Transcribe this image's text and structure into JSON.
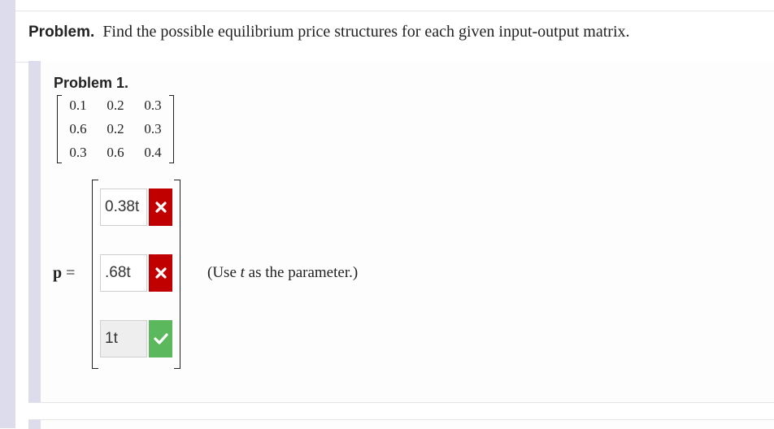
{
  "header": {
    "label": "Problem.",
    "text": "Find the possible equilibrium price structures for each given input-output matrix."
  },
  "problem": {
    "title": "Problem 1.",
    "matrix": [
      [
        "0.1",
        "0.2",
        "0.3"
      ],
      [
        "0.6",
        "0.2",
        "0.3"
      ],
      [
        "0.3",
        "0.6",
        "0.4"
      ]
    ],
    "vector_label": "p",
    "equals": "=",
    "answers": [
      {
        "value": "0.38t",
        "status": "incorrect",
        "icon": "x-icon",
        "color": "#c00000"
      },
      {
        "value": ".68t",
        "status": "incorrect",
        "icon": "x-icon",
        "color": "#c00000"
      },
      {
        "value": "1t",
        "status": "correct",
        "icon": "check-icon",
        "color": "#5cb85c"
      }
    ],
    "hint": {
      "prefix": "(Use ",
      "variable": "t",
      "suffix": " as the parameter.)"
    }
  }
}
